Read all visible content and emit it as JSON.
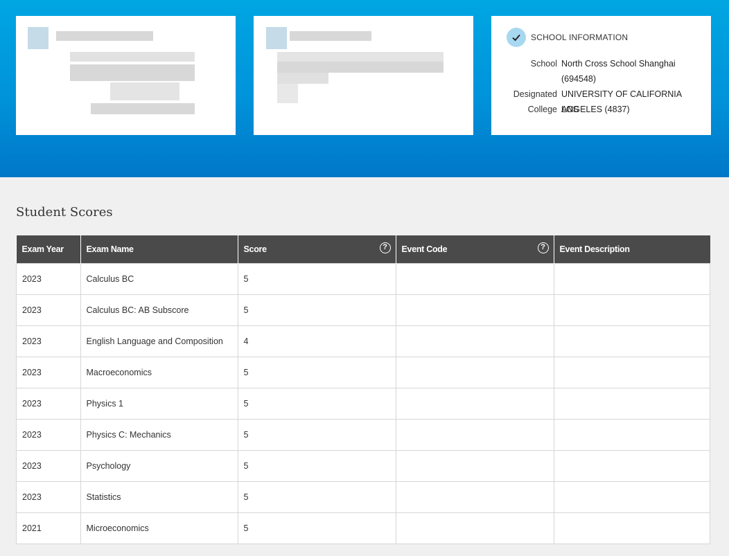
{
  "school_card": {
    "heading": "SCHOOL INFORMATION",
    "school_label": "School",
    "school_value_line1": "North Cross School Shanghai",
    "school_value_line2": "(694548)",
    "college_label_line1": "Designated",
    "college_label_line2": "College",
    "college_value_line1": "UNIVERSITY OF CALIFORNIA LOS",
    "college_value_line2": "ANGELES (4837)"
  },
  "scores": {
    "title": "Student Scores",
    "columns": [
      "Exam Year",
      "Exam Name",
      "Score",
      "Event Code",
      "Event Description"
    ],
    "help_glyph": "?",
    "rows": [
      {
        "year": "2023",
        "name": "Calculus BC",
        "score": "5",
        "event_code": "",
        "event_description": ""
      },
      {
        "year": "2023",
        "name": "Calculus BC: AB Subscore",
        "score": "5",
        "event_code": "",
        "event_description": ""
      },
      {
        "year": "2023",
        "name": "English Language and Composition",
        "score": "4",
        "event_code": "",
        "event_description": ""
      },
      {
        "year": "2023",
        "name": "Macroeconomics",
        "score": "5",
        "event_code": "",
        "event_description": ""
      },
      {
        "year": "2023",
        "name": "Physics 1",
        "score": "5",
        "event_code": "",
        "event_description": ""
      },
      {
        "year": "2023",
        "name": "Physics C: Mechanics",
        "score": "5",
        "event_code": "",
        "event_description": ""
      },
      {
        "year": "2023",
        "name": "Psychology",
        "score": "5",
        "event_code": "",
        "event_description": ""
      },
      {
        "year": "2023",
        "name": "Statistics",
        "score": "5",
        "event_code": "",
        "event_description": ""
      },
      {
        "year": "2021",
        "name": "Microeconomics",
        "score": "5",
        "event_code": "",
        "event_description": ""
      }
    ]
  },
  "colors": {
    "banner_top": "#00a6e2",
    "banner_bottom": "#0077c8",
    "table_header": "#4a4a4a",
    "check_circle": "#a8d8f0"
  }
}
